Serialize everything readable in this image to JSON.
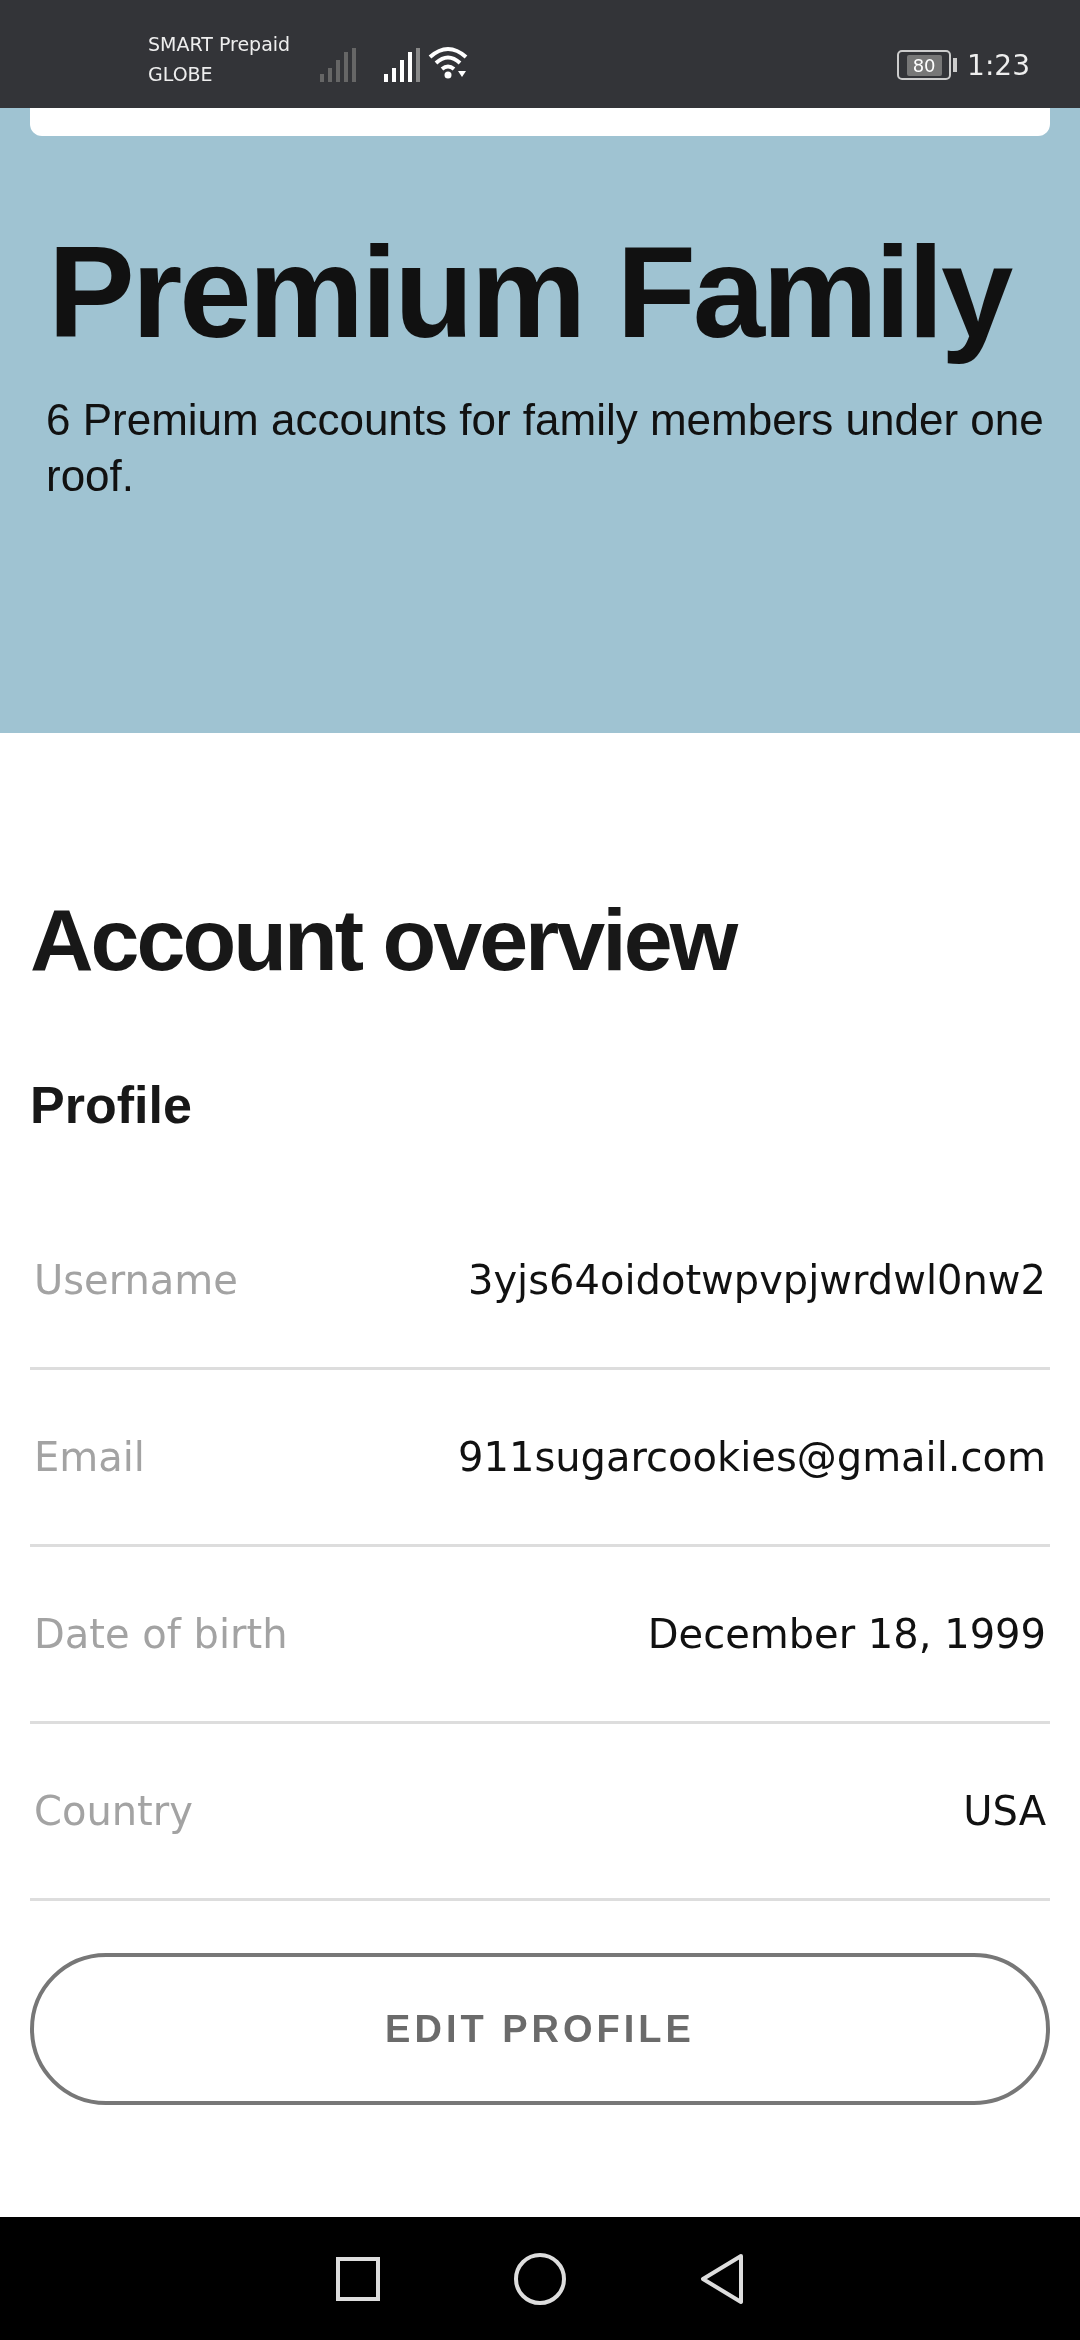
{
  "status_bar": {
    "carrier_1": "SMART Prepaid",
    "carrier_2": "GLOBE",
    "battery": "80",
    "time": "1:23"
  },
  "plan": {
    "title": "Premium Family",
    "description": "6 Premium accounts for family members under one roof."
  },
  "heading": "Account overview",
  "section": "Profile",
  "fields": [
    {
      "label": "Username",
      "value": "3yjs64oidotwpvpjwrdwl0nw2"
    },
    {
      "label": "Email",
      "value": "911sugarcookies@gmail.com"
    },
    {
      "label": "Date of birth",
      "value": "December 18, 1999"
    },
    {
      "label": "Country",
      "value": "USA"
    }
  ],
  "button": "EDIT PROFILE"
}
